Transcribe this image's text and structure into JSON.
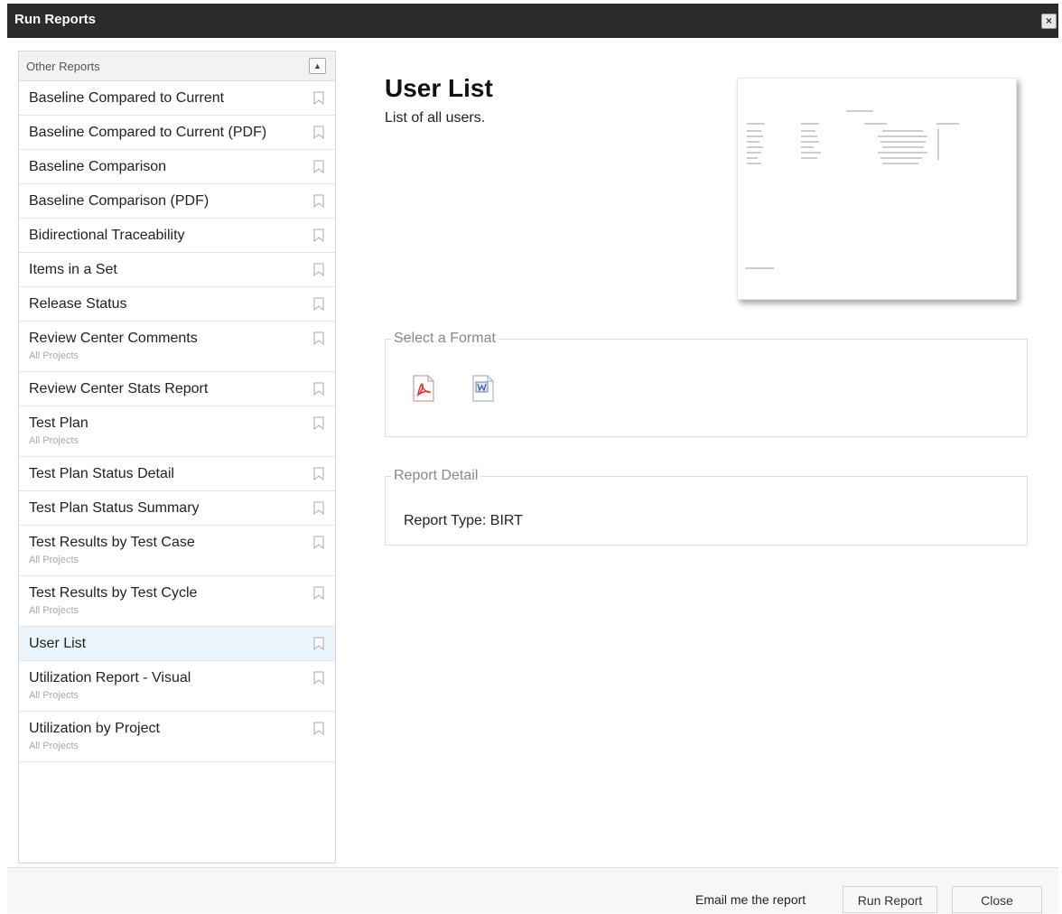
{
  "window": {
    "title": "Run Reports"
  },
  "sidebar": {
    "header": "Other Reports",
    "items": [
      {
        "label": "Baseline Compared to Current",
        "sub": ""
      },
      {
        "label": "Baseline Compared to Current (PDF)",
        "sub": ""
      },
      {
        "label": "Baseline Comparison",
        "sub": ""
      },
      {
        "label": "Baseline Comparison (PDF)",
        "sub": ""
      },
      {
        "label": "Bidirectional Traceability",
        "sub": ""
      },
      {
        "label": "Items in a Set",
        "sub": ""
      },
      {
        "label": "Release Status",
        "sub": ""
      },
      {
        "label": "Review Center Comments",
        "sub": "All Projects"
      },
      {
        "label": "Review Center Stats Report",
        "sub": ""
      },
      {
        "label": "Test Plan",
        "sub": "All Projects"
      },
      {
        "label": "Test Plan Status Detail",
        "sub": ""
      },
      {
        "label": "Test Plan Status Summary",
        "sub": ""
      },
      {
        "label": "Test Results by Test Case",
        "sub": "All Projects"
      },
      {
        "label": "Test Results by Test Cycle",
        "sub": "All Projects"
      },
      {
        "label": "User List",
        "sub": "",
        "selected": true
      },
      {
        "label": "Utilization Report - Visual",
        "sub": "All Projects"
      },
      {
        "label": "Utilization by Project",
        "sub": "All Projects"
      }
    ]
  },
  "main": {
    "title": "User List",
    "description": "List of all users.",
    "format_legend": "Select a Format",
    "formats": [
      {
        "name": "pdf-format-icon"
      },
      {
        "name": "word-format-icon"
      }
    ],
    "detail_legend": "Report Detail",
    "report_type_label": "Report Type:",
    "report_type_value": "BIRT"
  },
  "footer": {
    "email_label": "Email me the report",
    "run_label": "Run Report",
    "close_label": "Close"
  },
  "colors": {
    "titlebar": "#2b2b2b",
    "selected_row": "#e9f4fb"
  }
}
